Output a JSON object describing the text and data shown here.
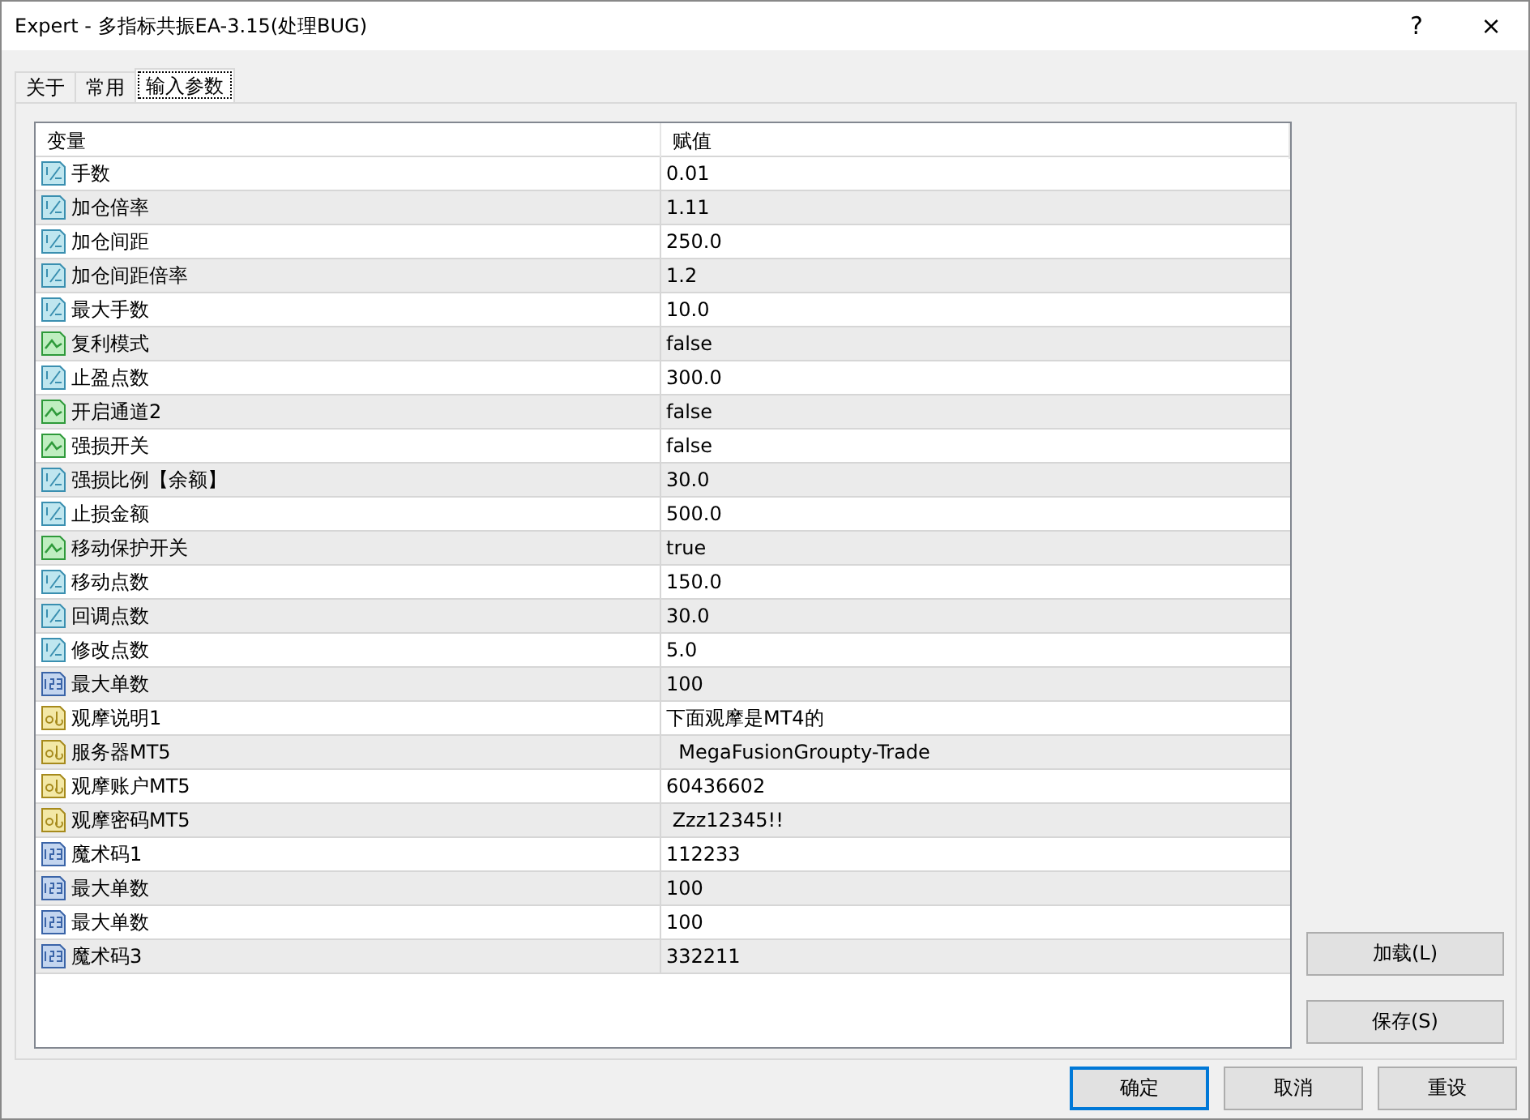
{
  "window": {
    "title": "Expert - 多指标共振EA-3.15(处理BUG)",
    "help": "?",
    "close": "×"
  },
  "tabs": [
    {
      "label": "关于",
      "selected": false
    },
    {
      "label": "常用",
      "selected": false
    },
    {
      "label": "输入参数",
      "selected": true
    }
  ],
  "table": {
    "columns": [
      "变量",
      "赋值"
    ],
    "rows": [
      {
        "kind": "double",
        "name": "手数",
        "value": "0.01"
      },
      {
        "kind": "double",
        "name": "加仓倍率",
        "value": "1.11"
      },
      {
        "kind": "double",
        "name": "加仓间距",
        "value": "250.0"
      },
      {
        "kind": "double",
        "name": "加仓间距倍率",
        "value": "1.2"
      },
      {
        "kind": "double",
        "name": "最大手数",
        "value": "10.0"
      },
      {
        "kind": "bool",
        "name": "复利模式",
        "value": "false"
      },
      {
        "kind": "double",
        "name": "止盈点数",
        "value": "300.0"
      },
      {
        "kind": "bool",
        "name": "开启通道2",
        "value": "false"
      },
      {
        "kind": "bool",
        "name": "强损开关",
        "value": "false"
      },
      {
        "kind": "double",
        "name": "强损比例【余额】",
        "value": "30.0"
      },
      {
        "kind": "double",
        "name": "止损金额",
        "value": "500.0"
      },
      {
        "kind": "bool",
        "name": "移动保护开关",
        "value": "true"
      },
      {
        "kind": "double",
        "name": "移动点数",
        "value": "150.0"
      },
      {
        "kind": "double",
        "name": "回调点数",
        "value": "30.0"
      },
      {
        "kind": "double",
        "name": "修改点数",
        "value": "5.0"
      },
      {
        "kind": "int",
        "name": "最大单数",
        "value": "100"
      },
      {
        "kind": "string",
        "name": "观摩说明1",
        "value": "下面观摩是MT4的"
      },
      {
        "kind": "string",
        "name": "服务器MT5",
        "value": "  MegaFusionGroupty-Trade"
      },
      {
        "kind": "string",
        "name": "观摩账户MT5",
        "value": "60436602"
      },
      {
        "kind": "string",
        "name": "观摩密码MT5",
        "value": " Zzz12345!!"
      },
      {
        "kind": "int",
        "name": "魔术码1",
        "value": "112233"
      },
      {
        "kind": "int",
        "name": "最大单数",
        "value": "100"
      },
      {
        "kind": "int",
        "name": "最大单数",
        "value": "100"
      },
      {
        "kind": "int",
        "name": "魔术码3",
        "value": "332211"
      }
    ]
  },
  "side_buttons": [
    "加载(L)",
    "保存(S)"
  ],
  "buttons": [
    {
      "label": "确定",
      "focused": true
    },
    {
      "label": "取消",
      "focused": false
    },
    {
      "label": "重设",
      "focused": false
    }
  ]
}
